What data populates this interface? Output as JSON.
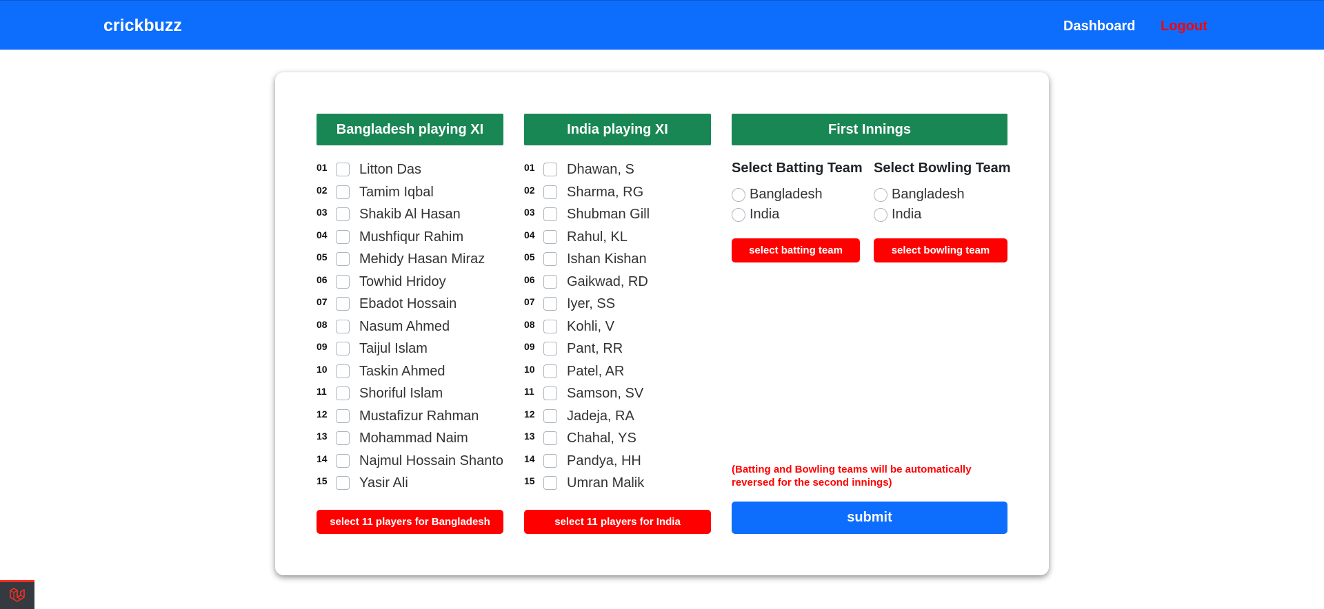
{
  "navbar": {
    "brand": "crickbuzz",
    "dashboard_label": "Dashboard",
    "logout_label": "Logout"
  },
  "team1": {
    "header": "Bangladesh playing XI",
    "players": [
      {
        "num": "01",
        "name": "Litton Das"
      },
      {
        "num": "02",
        "name": "Tamim Iqbal"
      },
      {
        "num": "03",
        "name": "Shakib Al Hasan"
      },
      {
        "num": "04",
        "name": "Mushfiqur Rahim"
      },
      {
        "num": "05",
        "name": "Mehidy Hasan Miraz"
      },
      {
        "num": "06",
        "name": "Towhid Hridoy"
      },
      {
        "num": "07",
        "name": "Ebadot Hossain"
      },
      {
        "num": "08",
        "name": "Nasum Ahmed"
      },
      {
        "num": "09",
        "name": "Taijul Islam"
      },
      {
        "num": "10",
        "name": "Taskin Ahmed"
      },
      {
        "num": "11",
        "name": "Shoriful Islam"
      },
      {
        "num": "12",
        "name": "Mustafizur Rahman"
      },
      {
        "num": "13",
        "name": "Mohammad Naim"
      },
      {
        "num": "14",
        "name": "Najmul Hossain Shanto"
      },
      {
        "num": "15",
        "name": "Yasir Ali"
      }
    ],
    "button_label": "select 11 players for Bangladesh"
  },
  "team2": {
    "header": "India playing XI",
    "players": [
      {
        "num": "01",
        "name": "Dhawan, S"
      },
      {
        "num": "02",
        "name": "Sharma, RG"
      },
      {
        "num": "03",
        "name": "Shubman Gill"
      },
      {
        "num": "04",
        "name": "Rahul, KL"
      },
      {
        "num": "05",
        "name": "Ishan Kishan"
      },
      {
        "num": "06",
        "name": "Gaikwad, RD"
      },
      {
        "num": "07",
        "name": "Iyer, SS"
      },
      {
        "num": "08",
        "name": "Kohli, V"
      },
      {
        "num": "09",
        "name": "Pant, RR"
      },
      {
        "num": "10",
        "name": "Patel, AR"
      },
      {
        "num": "11",
        "name": "Samson, SV"
      },
      {
        "num": "12",
        "name": "Jadeja, RA"
      },
      {
        "num": "13",
        "name": "Chahal, YS"
      },
      {
        "num": "14",
        "name": "Pandya, HH"
      },
      {
        "num": "15",
        "name": "Umran Malik"
      }
    ],
    "button_label": "select 11 players for India"
  },
  "innings": {
    "header": "First Innings",
    "batting": {
      "title": "Select Batting Team",
      "options": [
        "Bangladesh",
        "India"
      ],
      "button_label": "select batting team"
    },
    "bowling": {
      "title": "Select Bowling Team",
      "options": [
        "Bangladesh",
        "India"
      ],
      "button_label": "select bowling team"
    },
    "note": "(Batting and Bowling teams will be automatically reversed for the second innings)",
    "submit_label": "submit"
  },
  "colors": {
    "primary": "#0d6efd",
    "success": "#198754",
    "danger": "#ff0000"
  },
  "icons": {
    "corner": "laravel-logo-icon"
  }
}
